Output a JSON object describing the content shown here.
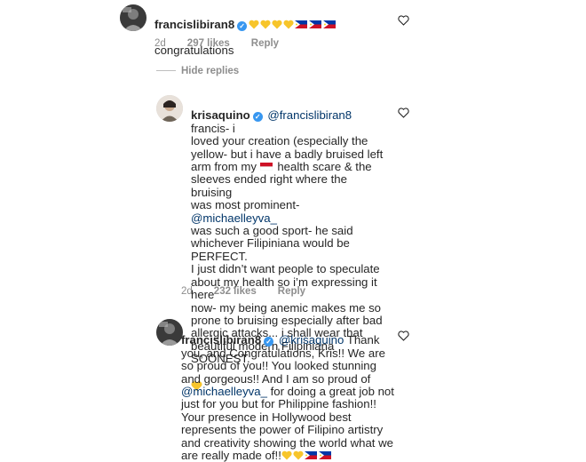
{
  "comments": [
    {
      "username": "francislibiran8",
      "text": "congratulations",
      "time": "2d",
      "likes": "297 likes",
      "reply_label": "Reply"
    },
    {
      "username": "krisaquino",
      "mention": "@francislibiran8",
      "text_a": "francis- i\nloved your creation (especially the\nyellow- but i have a badly bruised left\narm from my",
      "text_b": "health scare & the\nsleeves ended right where the bruising\nwas most prominent-",
      "mention2": "@michaelleyva_",
      "text_c": "\nwas such a good sport- he said\nwhichever Filipiniana would be PERFECT.\nI just didn’t want people to speculate\nabout my health so i’m expressing it here\nnow- my being anemic makes me so\nprone to bruising especially after bad\nallergic attacks... i shall wear that\nbeautiful modern Filipiniana SOONEST.",
      "time": "2d",
      "likes": "232 likes",
      "reply_label": "Reply"
    },
    {
      "username": "francislibiran8",
      "mention": "@krisaquino",
      "text_a": "Thank\nyou, and Congratulations, Kris!! We are\nso proud of you!! You looked stunning\nand gorgeous!! And I am so proud of\n",
      "mention2": "@michaelleyva_",
      "text_b": "for doing a great job not\njust for you but for Philippine fashion!!\nYour presence in Hollywood best\nrepresents the power of Filipino artistry\nand creativity showing the world what we\nare really made of!!"
    }
  ],
  "hide_replies_label": "Hide replies",
  "icons": {
    "heart": "heart-outline-icon",
    "verified": "verified-badge-icon",
    "yellow_heart": "yellow-heart-emoji",
    "flag": "philippine-flag-emoji"
  },
  "colors": {
    "mention": "#003569",
    "meta": "#8e8e8e",
    "verified": "#3897f0",
    "yellow_heart": "#f7c52b"
  }
}
